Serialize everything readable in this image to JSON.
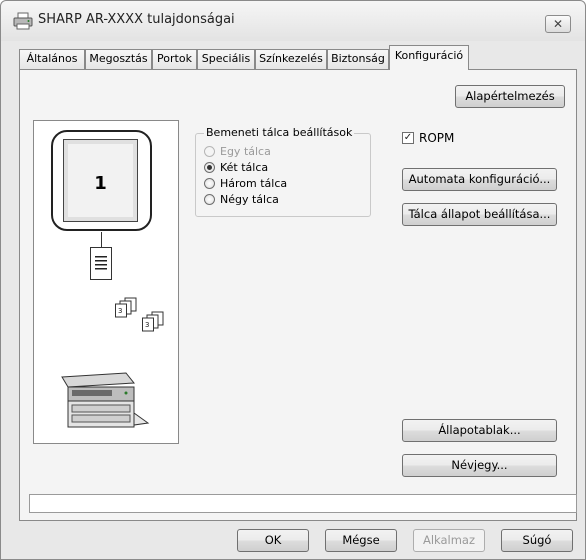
{
  "window": {
    "title": "SHARP AR-XXXX tulajdonságai",
    "close_glyph": "✕"
  },
  "tabs": [
    {
      "label": "Általános",
      "active": false
    },
    {
      "label": "Megosztás",
      "active": false
    },
    {
      "label": "Portok",
      "active": false
    },
    {
      "label": "Speciális",
      "active": false
    },
    {
      "label": "Színkezelés",
      "active": false
    },
    {
      "label": "Biztonság",
      "active": false
    },
    {
      "label": "Konfiguráció",
      "active": true
    }
  ],
  "config": {
    "defaults_button": "Alapértelmezés",
    "preview": {
      "tray_number": "1"
    },
    "input_tray": {
      "legend": "Bemeneti tálca beállítások",
      "options": [
        {
          "label": "Egy tálca",
          "checked": false,
          "disabled": true
        },
        {
          "label": "Két tálca",
          "checked": true,
          "disabled": false
        },
        {
          "label": "Három tálca",
          "checked": false,
          "disabled": false
        },
        {
          "label": "Négy tálca",
          "checked": false,
          "disabled": false
        }
      ]
    },
    "ropm": {
      "label": "ROPM",
      "checked": true,
      "check_glyph": "✓"
    },
    "auto_config_button": "Automata konfiguráció...",
    "tray_state_button": "Tálca állapot beállítása...",
    "status_window_button": "Állapotablak...",
    "about_button": "Névjegy..."
  },
  "footer": {
    "ok": "OK",
    "cancel": "Mégse",
    "apply": "Alkalmaz",
    "help": "Súgó"
  },
  "icons": {
    "printer_app": "printer-icon",
    "document": "document-icon",
    "collate": "collated-sets-icon",
    "copier": "copier-machine-icon"
  }
}
